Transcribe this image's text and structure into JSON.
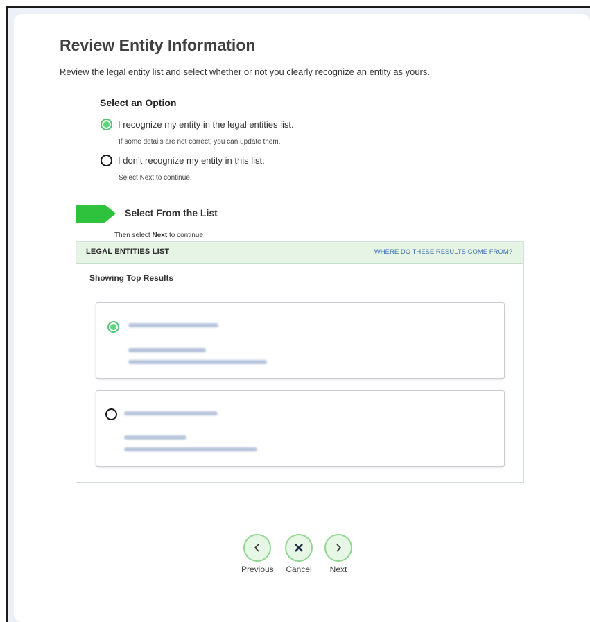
{
  "page": {
    "title": "Review Entity Information",
    "subtitle": "Review the legal entity list and select whether or not you clearly recognize an entity as yours."
  },
  "select_option": {
    "label": "Select an Option",
    "options": [
      {
        "label": "I recognize my entity in the legal entities list.",
        "help": "If some details are not correct, you can update them.",
        "selected": true
      },
      {
        "label": "I don’t recognize my entity in this list.",
        "help": "Select Next to continue.",
        "selected": false
      }
    ]
  },
  "list_section": {
    "heading": "Select From the List",
    "then_prefix": "Then select ",
    "then_bold": "Next",
    "then_suffix": " to continue"
  },
  "panel": {
    "title": "LEGAL ENTITIES LIST",
    "link": "WHERE DO THESE RESULTS COME FROM?",
    "subheading": "Showing Top Results",
    "entities": [
      {
        "selected": true
      },
      {
        "selected": false
      }
    ]
  },
  "nav": {
    "previous": "Previous",
    "cancel": "Cancel",
    "next": "Next"
  },
  "colors": {
    "accent_green": "#52c472",
    "link_blue": "#3a6fb0",
    "header_green": "#e6f4e6"
  }
}
